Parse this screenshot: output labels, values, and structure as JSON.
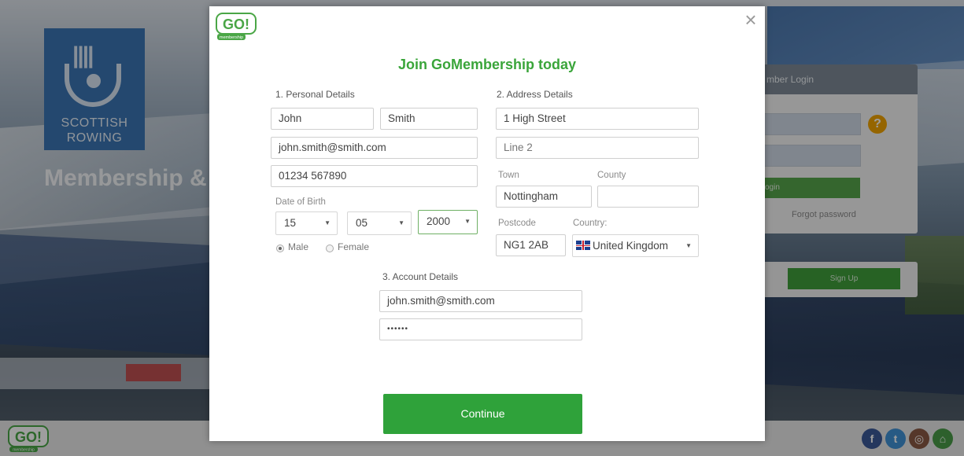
{
  "background": {
    "logo_text_line1": "SCOTTISH",
    "logo_text_line2": "ROWING",
    "heading": "Membership &",
    "login_header": "mber Login",
    "login_help_icon": "?",
    "login_button": "ogin",
    "forgot_password": "Forgot password",
    "signup_button": "Sign Up"
  },
  "footer": {
    "social_icons": [
      "facebook-icon",
      "twitter-icon",
      "instagram-icon",
      "home-icon"
    ],
    "social_glyphs": [
      "f",
      "t",
      "◎",
      "⌂"
    ]
  },
  "brand": {
    "logo_text": "GO!",
    "logo_subtext": "membership"
  },
  "modal": {
    "close_glyph": "×",
    "title": "Join GoMembership today",
    "personal": {
      "heading": "1. Personal Details",
      "first_name": "John",
      "last_name": "Smith",
      "email": "john.smith@smith.com",
      "phone": "01234 567890",
      "dob_label": "Date of Birth",
      "dob_day": "15",
      "dob_month": "05",
      "dob_year": "2000",
      "gender_male": "Male",
      "gender_female": "Female",
      "gender_selected": "Male"
    },
    "address": {
      "heading": "2. Address Details",
      "line1": "1 High Street",
      "line2_placeholder": "Line 2",
      "town_label": "Town",
      "town": "Nottingham",
      "county_label": "County",
      "county": "",
      "postcode_label": "Postcode",
      "postcode": "NG1 2AB",
      "country_label": "Country:",
      "country": "United Kingdom"
    },
    "account": {
      "heading": "3. Account Details",
      "email": "john.smith@smith.com",
      "password_mask": "••••••"
    },
    "continue_label": "Continue"
  },
  "colors": {
    "brand_green": "#2fa23a",
    "title_green": "#3aa53a",
    "scottish_blue": "#3b75b3"
  }
}
